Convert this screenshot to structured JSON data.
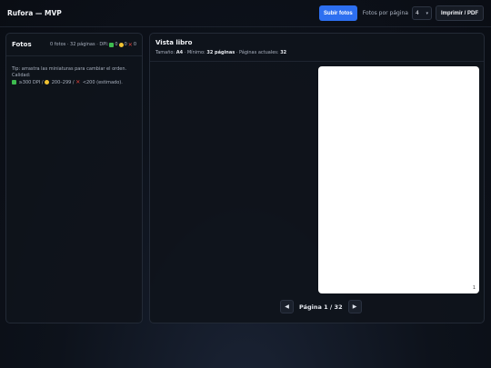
{
  "header": {
    "title": "Rufora — MVP",
    "upload_label": "Subir fotos",
    "per_page_label": "Fotos por página",
    "per_page_value": "4",
    "print_label": "Imprimir / PDF"
  },
  "photos_panel": {
    "title": "Fotos",
    "stats": "0 fotos · 32 páginas · DPI:",
    "dpi_good": "0",
    "dpi_mid": "0",
    "dpi_bad": "0",
    "tip_line1": "Tip: arrastra las miniaturas para cambiar el orden. Calidad:",
    "tip_good": "≥300 DPI /",
    "tip_mid": "200–299 /",
    "tip_bad": "<200 (estimado).",
    "icons": {
      "good": "check-square-icon",
      "mid": "yellow-circle-icon",
      "bad": "cross-mark-icon"
    },
    "colors": {
      "good": "#3dbb4f",
      "mid": "#f1c232",
      "bad": "#e0413a"
    }
  },
  "book_panel": {
    "title": "Vista libro",
    "size_label": "Tamaño:",
    "size_value": "A4",
    "min_label": "· Mínimo:",
    "min_value": "32 páginas",
    "current_label": "· Páginas actuales:",
    "current_value": "32",
    "page_number": "1"
  },
  "pager": {
    "prev": "◀",
    "next": "▶",
    "label": "Página 1 / 32"
  },
  "colors": {
    "accent": "#2d6ff0",
    "background": "#0d121b"
  }
}
